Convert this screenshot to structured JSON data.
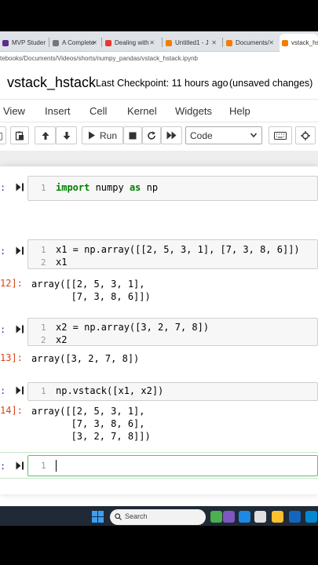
{
  "browser": {
    "tabs": [
      {
        "label": "MVP Studen",
        "color": "#5b2d8e"
      },
      {
        "label": "A Complete",
        "color": "#777777"
      },
      {
        "label": "Dealing with",
        "color": "#e53935"
      },
      {
        "label": "Untitled1 - J",
        "color": "#f57c00"
      },
      {
        "label": "Documents/",
        "color": "#f57c00"
      },
      {
        "label": "vstack_hs",
        "color": "#f57c00"
      }
    ],
    "url": "tebooks/Documents/Videos/shorts/numpy_pandas/vstack_hstack.ipynb"
  },
  "notebook": {
    "title": "vstack_hstack",
    "checkpoint": "Last Checkpoint: 11 hours ago",
    "status": "(unsaved changes)"
  },
  "menu": [
    "View",
    "Insert",
    "Cell",
    "Kernel",
    "Widgets",
    "Help"
  ],
  "toolbar": {
    "run_label": "Run",
    "cell_type": "Code"
  },
  "cells": [
    {
      "prompt": ":",
      "line_numbers": [
        "1"
      ]
    },
    {
      "prompt": ":",
      "line_numbers": [
        "1",
        "2"
      ],
      "code": [
        "x1 = np.array([[2, 5, 3, 1], [7, 3, 8, 6]])",
        "x1"
      ],
      "out_prompt": "12]:",
      "output": "array([[2, 5, 3, 1],\n       [7, 3, 8, 6]])"
    },
    {
      "prompt": ":",
      "line_numbers": [
        "1",
        "2"
      ],
      "code": [
        "x2 = np.array([3, 2, 7, 8])",
        "x2"
      ],
      "out_prompt": "13]:",
      "output": "array([3, 2, 7, 8])"
    },
    {
      "prompt": ":",
      "line_numbers": [
        "1"
      ],
      "code": [
        "np.vstack([x1, x2])"
      ],
      "out_prompt": "14]:",
      "output": "array([[2, 5, 3, 1],\n       [7, 3, 8, 6],\n       [3, 2, 7, 8]])"
    },
    {
      "prompt": ":",
      "line_numbers": [
        "1"
      ]
    }
  ],
  "code_tokens": {
    "import_kw": "import",
    "module": " numpy ",
    "as_kw": "as",
    "alias": " np"
  },
  "taskbar": {
    "search_placeholder": "Search"
  }
}
